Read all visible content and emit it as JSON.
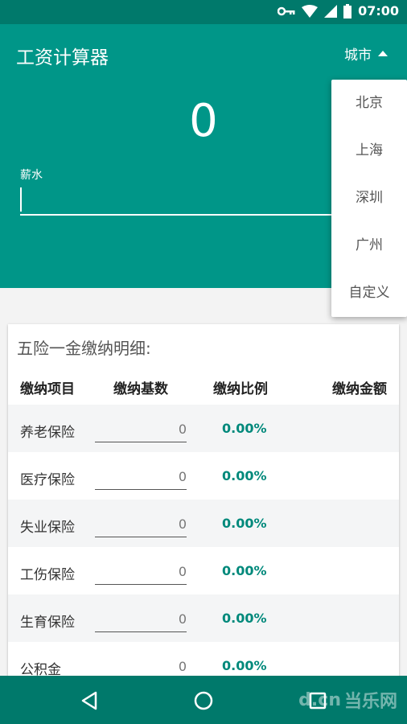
{
  "status_bar": {
    "time": "07:00",
    "icons": [
      "key-icon",
      "wifi-icon",
      "signal-icon",
      "battery-icon"
    ]
  },
  "app": {
    "title": "工资计算器",
    "city_button": "城市",
    "result": "0",
    "salary_label": "薪水",
    "salary_value": ""
  },
  "city_menu": {
    "items": [
      "北京",
      "上海",
      "深圳",
      "广州",
      "自定义"
    ]
  },
  "table": {
    "title": "五险一金缴纳明细:",
    "headers": [
      "缴纳项目",
      "缴纳基数",
      "缴纳比例",
      "缴纳金额"
    ],
    "rows": [
      {
        "name": "养老保险",
        "base": "0",
        "rate": "0.00%",
        "amount": ""
      },
      {
        "name": "医疗保险",
        "base": "0",
        "rate": "0.00%",
        "amount": ""
      },
      {
        "name": "失业保险",
        "base": "0",
        "rate": "0.00%",
        "amount": ""
      },
      {
        "name": "工伤保险",
        "base": "0",
        "rate": "0.00%",
        "amount": ""
      },
      {
        "name": "生育保险",
        "base": "0",
        "rate": "0.00%",
        "amount": ""
      },
      {
        "name": "公积金",
        "base": "0",
        "rate": "0.00%",
        "amount": ""
      }
    ]
  },
  "nav_bar": {
    "icons": [
      "back-icon",
      "home-icon",
      "recents-icon"
    ]
  },
  "watermark": {
    "text": "当乐网"
  },
  "colors": {
    "primary": "#009688",
    "primary_dark": "#00796b",
    "accent_text": "#00897b"
  }
}
